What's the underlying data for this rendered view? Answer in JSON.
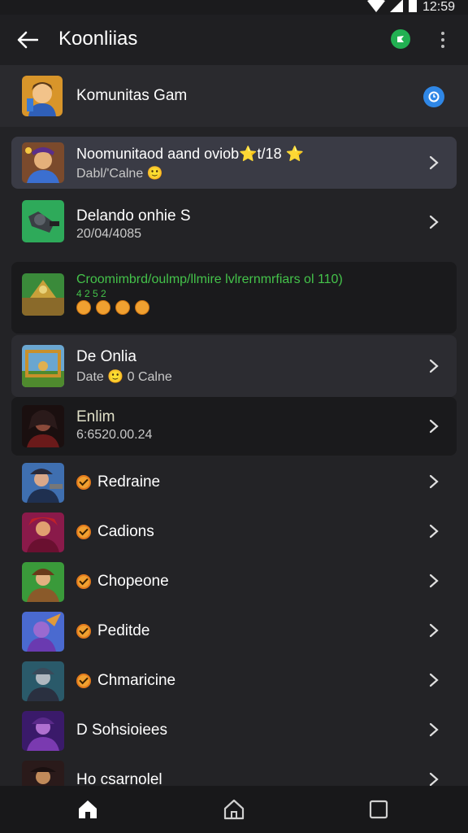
{
  "status_bar": {
    "time": "12:59",
    "icons": [
      "wifi-icon",
      "signal-icon",
      "battery-icon"
    ]
  },
  "app_bar": {
    "title": "Koonliias",
    "back_icon": "back-arrow-icon",
    "badge_icon": "green-check-icon",
    "menu_icon": "more-vert-icon"
  },
  "community": {
    "name": "Komunitas Gam",
    "badge_icon": "blue-clock-icon"
  },
  "featured": [
    {
      "title": "Noomunitaod aand oviob⭐t/18 ⭐",
      "subtitle": "Dabl/'Calne 🙂"
    },
    {
      "title": "Delando onhie S",
      "subtitle": "20/04/4085"
    }
  ],
  "announcement": {
    "title": "Croomimbrd/oulmp/llmire lvlrernmrfiars ol 110)",
    "subtitle": "4 2 5 2"
  },
  "games": [
    {
      "title": "De Onlia",
      "subtitle": "Date 🙂 0 Calne"
    },
    {
      "title": "Enlim",
      "subtitle": "6:6520.00.24"
    }
  ],
  "members": [
    {
      "name": "Redraine"
    },
    {
      "name": "Cadions"
    },
    {
      "name": "Chopeone"
    },
    {
      "name": "Peditde"
    },
    {
      "name": "Chmaricine"
    },
    {
      "name": "D Sohsioiees"
    },
    {
      "name": "Ho csarnolel"
    }
  ],
  "nav": {
    "icons": [
      "home-icon",
      "home-outline-icon",
      "square-icon"
    ]
  },
  "colors": {
    "accent_green": "#22b052",
    "accent_blue": "#2f87e6",
    "orange": "#f0a030",
    "announcement_text": "#44c24a"
  }
}
